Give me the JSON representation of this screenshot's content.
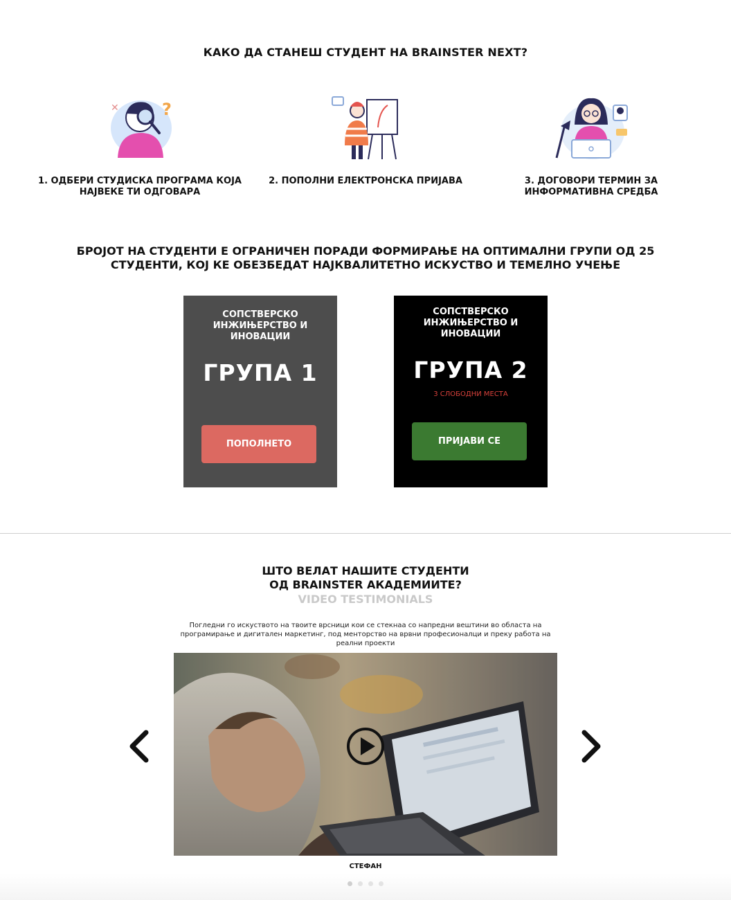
{
  "how_to": {
    "title": "КАКО ДА СТАНЕШ СТУДЕНТ НА BRAINSTER NEXT?",
    "steps": [
      {
        "label": "1. ОДБЕРИ СТУДИСКА ПРОГРАМА КОЈА НАЈВЕКЕ ТИ ОДГОВАРА",
        "icon": "magnifier-person-illustration"
      },
      {
        "label": "2. ПОПОЛНИ ЕЛЕКТРОНСКА ПРИЈАВА",
        "icon": "painter-easel-illustration"
      },
      {
        "label": "3. ДОГОВОРИ ТЕРМИН ЗА ИНФОРМАТИВНА СРЕДБА",
        "icon": "laptop-chat-illustration"
      }
    ]
  },
  "limit": {
    "title": "БРОЈОТ НА СТУДЕНТИ Е ОГРАНИЧЕН ПОРАДИ ФОРМИРАЊЕ НА ОПТИМАЛНИ ГРУПИ ОД 25 СТУДЕНТИ, КОЈ КЕ ОБЕЗБЕДАТ НАЈКВАЛИТЕТНО ИСКУСТВО И ТЕМЕЛНО УЧЕЊЕ"
  },
  "groups": [
    {
      "program": "СОПСТВЕРСКО ИНЖИЊЕРСТВО И ИНОВАЦИИ",
      "name": "ГРУПА 1",
      "seats": "",
      "button": "ПОПОЛНЕТО",
      "color": "#4d4d4d",
      "button_color": "#dc6961"
    },
    {
      "program": "СОПСТВЕРСКО ИНЖИЊЕРСТВО И ИНОВАЦИИ",
      "name": "ГРУПА 2",
      "seats": "3 СЛОБОДНИ МЕСТА",
      "button": "ПРИЈАВИ СЕ",
      "color": "#000000",
      "button_color": "#3b7a31"
    }
  ],
  "testimonials": {
    "title_line1": "ШТО ВЕЛАТ НАШИТЕ СТУДЕНТИ",
    "title_line2": "ОД BRAINSTER АКАДЕМИИТЕ?",
    "subtitle": "VIDEO TESTIMONIALS",
    "description": "Погледни го искуството на твоите врсници кои се стекнаа со напредни вештини во областа на програмирање и дигитален маркетинг, под менторство на врвни професионалци и преку работа на реални проекти",
    "student_name": "СТЕФАН",
    "slide_count": 4,
    "active_slide": 1
  }
}
